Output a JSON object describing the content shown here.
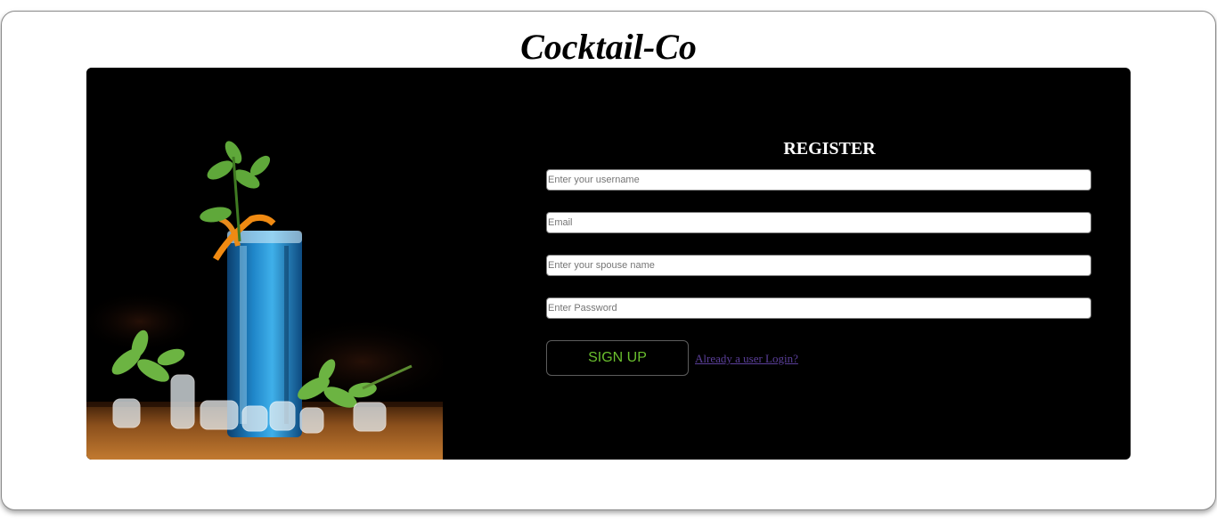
{
  "header": {
    "title": "Cocktail-Co"
  },
  "form": {
    "heading": "REGISTER",
    "fields": {
      "username": {
        "placeholder": "Enter your username",
        "value": ""
      },
      "email": {
        "placeholder": "Email",
        "value": ""
      },
      "spouse": {
        "placeholder": "Enter your spouse name",
        "value": ""
      },
      "password": {
        "placeholder": "Enter Password",
        "value": ""
      }
    },
    "submit_label": "SIGN UP",
    "login_link": "Already a user Login?"
  },
  "image": {
    "subject": "blue-cocktail-photo"
  },
  "colors": {
    "card_background": "#000000",
    "button_text": "#6abf2e",
    "link": "#5b3f9a",
    "title_text": "#000000"
  }
}
